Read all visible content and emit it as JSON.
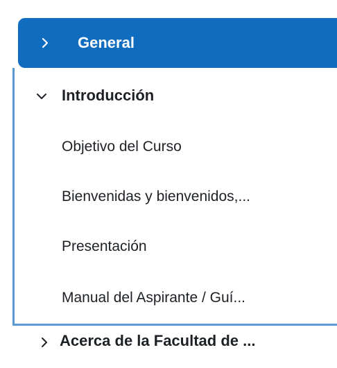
{
  "sections": [
    {
      "label": "General",
      "icon": "chevron-right-icon",
      "state": "active",
      "color": "#0f6cbf"
    },
    {
      "label": "Acerca de la Facultad de ...",
      "icon": "chevron-right-icon",
      "state": "collapsed"
    }
  ],
  "subsection": {
    "label": "Introducción",
    "icon": "chevron-down-icon",
    "state": "expanded",
    "border_color": "#5b9bd5",
    "items": [
      {
        "label": "Objetivo del Curso"
      },
      {
        "label": "Bienvenidas y bienvenidos,..."
      },
      {
        "label": "Presentación"
      },
      {
        "label": "Manual del Aspirante / Guí..."
      }
    ]
  }
}
